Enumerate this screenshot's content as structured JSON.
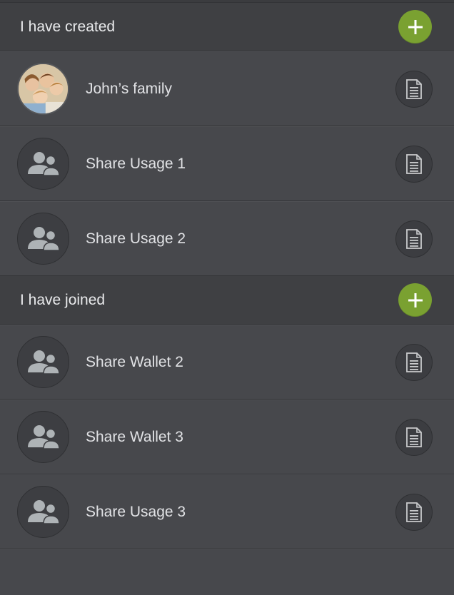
{
  "colors": {
    "accent": "#7aa131",
    "background": "#47484c",
    "header": "#3f4043"
  },
  "sections": [
    {
      "title": "I have created",
      "add_icon": "plus-icon",
      "items": [
        {
          "label": "John’s family",
          "avatar": "family-photo",
          "action_icon": "document-icon"
        },
        {
          "label": "Share Usage 1",
          "avatar": "group-users-icon",
          "action_icon": "document-icon"
        },
        {
          "label": "Share Usage 2",
          "avatar": "group-users-icon",
          "action_icon": "document-icon"
        }
      ]
    },
    {
      "title": "I have joined",
      "add_icon": "plus-icon",
      "items": [
        {
          "label": "Share Wallet 2",
          "avatar": "group-users-icon",
          "action_icon": "document-icon"
        },
        {
          "label": "Share Wallet 3",
          "avatar": "group-users-icon",
          "action_icon": "document-icon"
        },
        {
          "label": "Share Usage 3",
          "avatar": "group-users-icon",
          "action_icon": "document-icon"
        }
      ]
    }
  ]
}
